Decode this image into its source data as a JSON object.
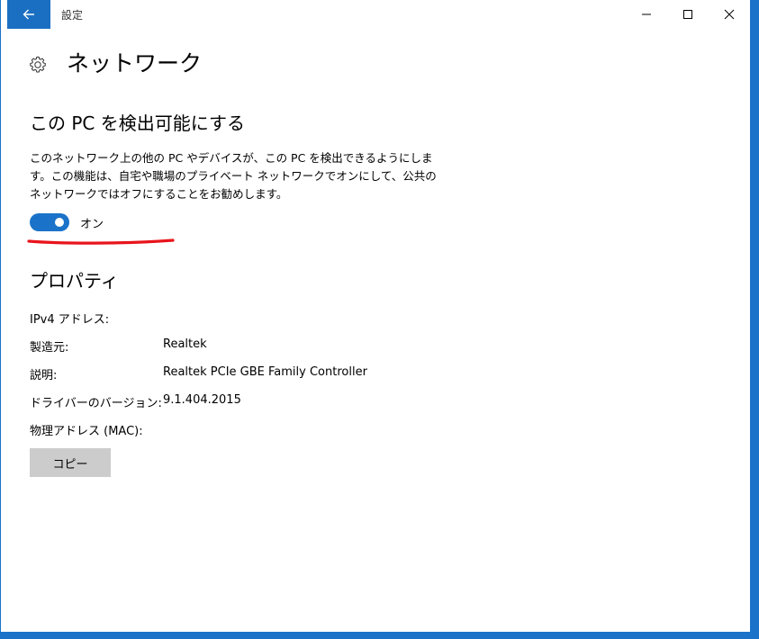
{
  "window": {
    "app_title": "設定"
  },
  "page": {
    "title": "ネットワーク"
  },
  "discoverable": {
    "title": "この PC を検出可能にする",
    "description_lines": [
      "このネットワーク上の他の PC やデバイスが、この PC を検出できるようにしま",
      "す。この機能は、自宅や職場のプライベート ネットワークでオンにして、公共の",
      "ネットワークではオフにすることをお勧めします。"
    ],
    "toggle_state": "on",
    "toggle_label": "オン"
  },
  "properties": {
    "title": "プロパティ",
    "rows": [
      {
        "label": "IPv4 アドレス:",
        "value": ""
      },
      {
        "label": "製造元:",
        "value": "Realtek"
      },
      {
        "label": "説明:",
        "value": "Realtek PCIe GBE Family Controller"
      },
      {
        "label": "ドライバーのバージョン:",
        "value": "9.1.404.2015"
      },
      {
        "label": "物理アドレス (MAC):",
        "value": ""
      }
    ],
    "copy_button": "コピー"
  },
  "colors": {
    "accent": "#1a73c9",
    "annotation": "#e8141c",
    "button_bg": "#cccccc"
  },
  "icons": [
    "back-arrow-icon",
    "minimize-icon",
    "maximize-icon",
    "close-icon",
    "gear-icon"
  ]
}
